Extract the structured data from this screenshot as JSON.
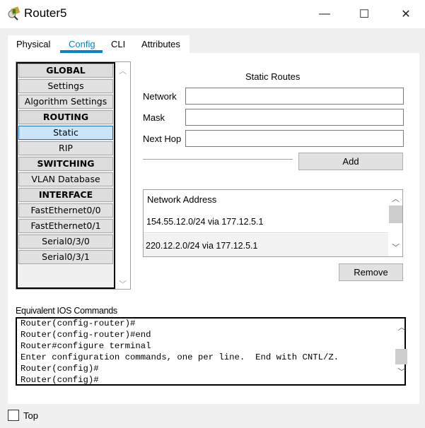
{
  "window": {
    "title": "Router5",
    "icon": "router-app-icon",
    "controls": {
      "minimize": "—",
      "maximize": "☐",
      "close": "✕"
    }
  },
  "tabs": [
    {
      "label": "Physical"
    },
    {
      "label": "Config",
      "active": true
    },
    {
      "label": "CLI"
    },
    {
      "label": "Attributes"
    }
  ],
  "sidebar": {
    "items": [
      {
        "label": "GLOBAL",
        "header": true
      },
      {
        "label": "Settings"
      },
      {
        "label": "Algorithm Settings"
      },
      {
        "label": "ROUTING",
        "header": true
      },
      {
        "label": "Static",
        "selected": true
      },
      {
        "label": "RIP"
      },
      {
        "label": "SWITCHING",
        "header": true
      },
      {
        "label": "VLAN Database"
      },
      {
        "label": "INTERFACE",
        "header": true
      },
      {
        "label": "FastEthernet0/0"
      },
      {
        "label": "FastEthernet0/1"
      },
      {
        "label": "Serial0/3/0"
      },
      {
        "label": "Serial0/3/1"
      }
    ]
  },
  "static_routes": {
    "title": "Static Routes",
    "network_label": "Network",
    "network_value": "",
    "mask_label": "Mask",
    "mask_value": "",
    "next_hop_label": "Next Hop",
    "next_hop_value": "",
    "add_label": "Add",
    "list_header": "Network Address",
    "routes": [
      "154.55.12.0/24 via 177.12.5.1",
      "220.12.2.0/24 via 177.12.5.1"
    ],
    "remove_label": "Remove"
  },
  "ios": {
    "label": "Equivalent IOS Commands",
    "lines": [
      "Router(config-router)#",
      "Router(config-router)#end",
      "Router#configure terminal",
      "Enter configuration commands, one per line.  End with CNTL/Z.",
      "Router(config)#",
      "Router(config)#"
    ]
  },
  "footer": {
    "top_label": "Top",
    "top_checked": false
  },
  "colors": {
    "accent": "#0a84c6",
    "selected": "#cce4f7"
  }
}
